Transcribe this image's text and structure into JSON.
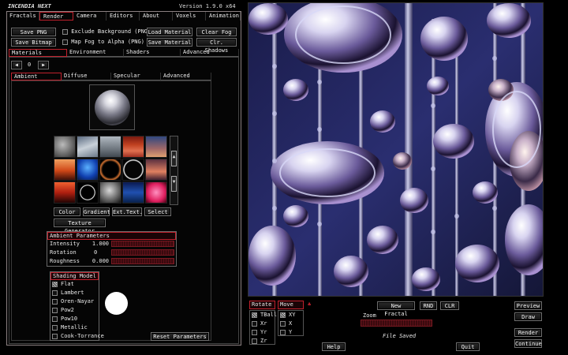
{
  "app": {
    "title": "INCENDIA NEXT",
    "version": "Version 1.9.0 x64"
  },
  "menu": [
    {
      "label": "Fractals",
      "active": false
    },
    {
      "label": "Render",
      "active": true
    },
    {
      "label": "Camera",
      "active": false
    },
    {
      "label": "Editors",
      "active": false
    },
    {
      "label": "About",
      "active": false
    },
    {
      "label": "Voxels",
      "active": false
    },
    {
      "label": "Animation",
      "active": false
    }
  ],
  "toolbar": {
    "save_png": "Save PNG",
    "save_bitmap": "Save Bitmap",
    "exclude_bg": "Exclude Background (PNG)",
    "map_fog": "Map Fog to Alpha (PNG)",
    "load_material": "Load Material",
    "save_material": "Save Material",
    "clear_fog": "Clear Fog",
    "clr_shadows": "Clr. Shadows"
  },
  "render_tabs": [
    "Materials",
    "Environment",
    "Shaders",
    "Advanced"
  ],
  "material_index": "0",
  "material_tabs": [
    "Ambient",
    "Diffuse",
    "Specular",
    "Advanced"
  ],
  "palette_buttons": [
    "Color",
    "Gradient",
    "Ext.Text.",
    "Select"
  ],
  "texture_generator": "Texture Generator",
  "ambient": {
    "header": "Ambient Parameters",
    "params": [
      {
        "label": "Intensity",
        "value": "1.000"
      },
      {
        "label": "Rotation",
        "value": "0"
      },
      {
        "label": "Roughness",
        "value": "0.000"
      }
    ]
  },
  "shading": {
    "header": "Shading Model",
    "options": [
      {
        "label": "Flat",
        "checked": true
      },
      {
        "label": "Lambert",
        "checked": false
      },
      {
        "label": "Oren-Nayar",
        "checked": false
      },
      {
        "label": "Pow2",
        "checked": false
      },
      {
        "label": "Pow10",
        "checked": false
      },
      {
        "label": "Metallic",
        "checked": false
      },
      {
        "label": "Cook-Torrance",
        "checked": false
      }
    ]
  },
  "reset_parameters": "Reset Parameters",
  "bottom": {
    "rotate": "Rotate",
    "rotate_options": [
      {
        "label": "TBall",
        "checked": true
      },
      {
        "label": "Xr",
        "checked": false
      },
      {
        "label": "Yr",
        "checked": false
      },
      {
        "label": "Zr",
        "checked": false
      }
    ],
    "move": "Move",
    "move_options": [
      {
        "label": "XY",
        "checked": true
      },
      {
        "label": "X",
        "checked": false
      },
      {
        "label": "Y",
        "checked": false
      }
    ],
    "new_fractal": "New Fractal",
    "rnd": "RND",
    "clr": "CLR",
    "zoom": "Zoom",
    "status": "File Saved",
    "help": "Help",
    "quit": "Quit",
    "preview": "Preview",
    "draw": "Draw",
    "render": "Render",
    "continue": "Continue"
  },
  "colors": {
    "accent": "#c0202c",
    "border": "#8a7f80",
    "background": "#000000"
  }
}
